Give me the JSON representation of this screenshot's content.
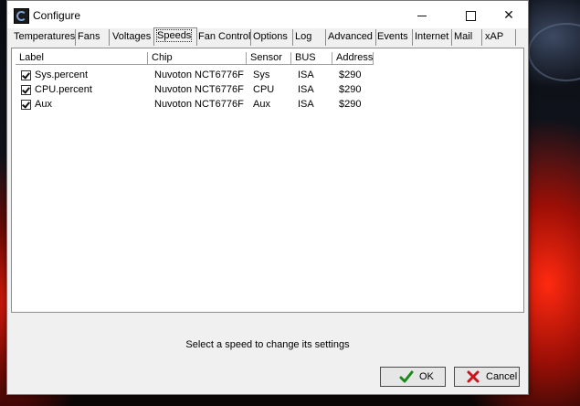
{
  "window": {
    "title": "Configure"
  },
  "tabs": [
    {
      "label": "Temperatures"
    },
    {
      "label": "Fans"
    },
    {
      "label": "Voltages"
    },
    {
      "label": "Speeds"
    },
    {
      "label": "Fan Control"
    },
    {
      "label": "Options"
    },
    {
      "label": "Log"
    },
    {
      "label": "Advanced"
    },
    {
      "label": "Events"
    },
    {
      "label": "Internet"
    },
    {
      "label": "Mail"
    },
    {
      "label": "xAP"
    }
  ],
  "active_tab": "Speeds",
  "table": {
    "columns": [
      "Label",
      "Chip",
      "Sensor",
      "BUS",
      "Address"
    ],
    "rows": [
      {
        "checked": true,
        "label": "Sys.percent",
        "chip": "Nuvoton NCT6776F",
        "sensor": "Sys",
        "bus": "ISA",
        "address": "$290"
      },
      {
        "checked": true,
        "label": "CPU.percent",
        "chip": "Nuvoton NCT6776F",
        "sensor": "CPU",
        "bus": "ISA",
        "address": "$290"
      },
      {
        "checked": true,
        "label": "Aux",
        "chip": "Nuvoton NCT6776F",
        "sensor": "Aux",
        "bus": "ISA",
        "address": "$290"
      }
    ]
  },
  "status_text": "Select a speed to change its settings",
  "buttons": {
    "ok": "OK",
    "cancel": "Cancel"
  },
  "colors": {
    "ok_check": "#1a8a1a",
    "cancel_x": "#c8141a"
  }
}
